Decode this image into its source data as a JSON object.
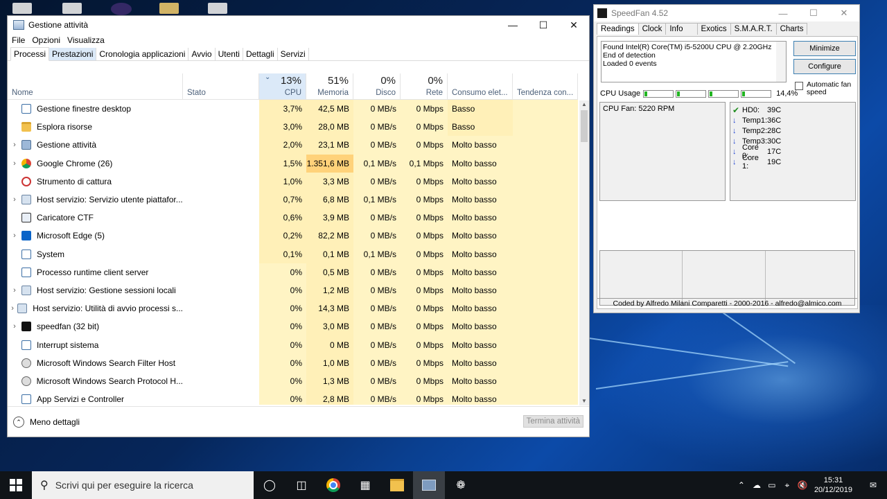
{
  "taskmanager": {
    "title": "Gestione attività",
    "menu": [
      "File",
      "Opzioni",
      "Visualizza"
    ],
    "tabs": [
      "Processi",
      "Prestazioni",
      "Cronologia applicazioni",
      "Avvio",
      "Utenti",
      "Dettagli",
      "Servizi"
    ],
    "columns": {
      "name": "Nome",
      "status": "Stato",
      "cpu_label": "CPU",
      "cpu_pct": "13%",
      "mem_label": "Memoria",
      "mem_pct": "51%",
      "disk_label": "Disco",
      "disk_pct": "0%",
      "net_label": "Rete",
      "net_pct": "0%",
      "power": "Consumo elet...",
      "trend": "Tendenza con..."
    },
    "processes": [
      {
        "name": "Gestione finestre desktop",
        "expand": false,
        "cpu": "3,7%",
        "mem": "42,5 MB",
        "disk": "0 MB/s",
        "net": "0 Mbps",
        "power": "Basso",
        "icon": "window-icon"
      },
      {
        "name": "Esplora risorse",
        "expand": false,
        "cpu": "3,0%",
        "mem": "28,0 MB",
        "disk": "0 MB/s",
        "net": "0 Mbps",
        "power": "Basso",
        "icon": "folder-icon"
      },
      {
        "name": "Gestione attività",
        "expand": true,
        "cpu": "2,0%",
        "mem": "23,1 MB",
        "disk": "0 MB/s",
        "net": "0 Mbps",
        "power": "Molto basso",
        "icon": "taskmanager-icon"
      },
      {
        "name": "Google Chrome (26)",
        "expand": true,
        "cpu": "1,5%",
        "mem": "1.351,6 MB",
        "disk": "0,1 MB/s",
        "net": "0,1 Mbps",
        "power": "Molto basso",
        "icon": "chrome-icon"
      },
      {
        "name": "Strumento di cattura",
        "expand": false,
        "cpu": "1,0%",
        "mem": "3,3 MB",
        "disk": "0 MB/s",
        "net": "0 Mbps",
        "power": "Molto basso",
        "icon": "scissors-icon"
      },
      {
        "name": "Host servizio: Servizio utente piattafor...",
        "expand": true,
        "cpu": "0,7%",
        "mem": "6,8 MB",
        "disk": "0,1 MB/s",
        "net": "0 Mbps",
        "power": "Molto basso",
        "icon": "gear-icon"
      },
      {
        "name": "Caricatore CTF",
        "expand": false,
        "cpu": "0,6%",
        "mem": "3,9 MB",
        "disk": "0 MB/s",
        "net": "0 Mbps",
        "power": "Molto basso",
        "icon": "pen-icon"
      },
      {
        "name": "Microsoft Edge (5)",
        "expand": true,
        "cpu": "0,2%",
        "mem": "82,2 MB",
        "disk": "0 MB/s",
        "net": "0 Mbps",
        "power": "Molto basso",
        "icon": "edge-icon"
      },
      {
        "name": "System",
        "expand": false,
        "cpu": "0,1%",
        "mem": "0,1 MB",
        "disk": "0,1 MB/s",
        "net": "0 Mbps",
        "power": "Molto basso",
        "icon": "window-icon"
      },
      {
        "name": "Processo runtime client server",
        "expand": false,
        "cpu": "0%",
        "mem": "0,5 MB",
        "disk": "0 MB/s",
        "net": "0 Mbps",
        "power": "Molto basso",
        "icon": "window-icon"
      },
      {
        "name": "Host servizio: Gestione sessioni locali",
        "expand": true,
        "cpu": "0%",
        "mem": "1,2 MB",
        "disk": "0 MB/s",
        "net": "0 Mbps",
        "power": "Molto basso",
        "icon": "gear-icon"
      },
      {
        "name": "Host servizio: Utilità di avvio processi s...",
        "expand": true,
        "cpu": "0%",
        "mem": "14,3 MB",
        "disk": "0 MB/s",
        "net": "0 Mbps",
        "power": "Molto basso",
        "icon": "gear-icon"
      },
      {
        "name": "speedfan (32 bit)",
        "expand": true,
        "cpu": "0%",
        "mem": "3,0 MB",
        "disk": "0 MB/s",
        "net": "0 Mbps",
        "power": "Molto basso",
        "icon": "fan-icon"
      },
      {
        "name": "Interrupt sistema",
        "expand": false,
        "cpu": "0%",
        "mem": "0 MB",
        "disk": "0 MB/s",
        "net": "0 Mbps",
        "power": "Molto basso",
        "icon": "window-icon"
      },
      {
        "name": "Microsoft Windows Search Filter Host",
        "expand": false,
        "cpu": "0%",
        "mem": "1,0 MB",
        "disk": "0 MB/s",
        "net": "0 Mbps",
        "power": "Molto basso",
        "icon": "search-person-icon"
      },
      {
        "name": "Microsoft Windows Search Protocol H...",
        "expand": false,
        "cpu": "0%",
        "mem": "1,3 MB",
        "disk": "0 MB/s",
        "net": "0 Mbps",
        "power": "Molto basso",
        "icon": "search-person-icon"
      },
      {
        "name": "App Servizi e Controller",
        "expand": false,
        "cpu": "0%",
        "mem": "2,8 MB",
        "disk": "0 MB/s",
        "net": "0 Mbps",
        "power": "Molto basso",
        "icon": "window-icon"
      }
    ],
    "footer": {
      "less_details": "Meno dettagli",
      "end_task": "Termina attività"
    }
  },
  "speedfan": {
    "title": "SpeedFan 4.52",
    "tabs": [
      "Readings",
      "Clock",
      "Info",
      "Exotics",
      "S.M.A.R.T.",
      "Charts"
    ],
    "log": [
      "Found Intel(R) Core(TM) i5-5200U CPU @ 2.20GHz",
      "End of detection",
      "Loaded 0 events"
    ],
    "buttons": {
      "minimize": "Minimize",
      "configure": "Configure"
    },
    "cpu_usage_label": "CPU Usage",
    "cpu_usage_value": "14,4%",
    "cpu_bars": [
      0.1,
      0.1,
      0.1,
      0.1
    ],
    "auto_fan_label": "Automatic fan speed",
    "fans": [
      "CPU Fan: 5220 RPM"
    ],
    "temps": [
      {
        "label": "HD0:",
        "value": "39C",
        "icon": "check"
      },
      {
        "label": "Temp1:",
        "value": "36C",
        "icon": "down"
      },
      {
        "label": "Temp2:",
        "value": "28C",
        "icon": "down"
      },
      {
        "label": "Temp3:",
        "value": "30C",
        "icon": "down"
      },
      {
        "label": "Core 0:",
        "value": "17C",
        "icon": "down"
      },
      {
        "label": "Core 1:",
        "value": "19C",
        "icon": "down"
      }
    ],
    "footer": "Coded by Alfredo Milani Comparetti - 2000-2016 - alfredo@almico.com"
  },
  "taskbar": {
    "search_placeholder": "Scrivi qui per eseguire la ricerca",
    "time": "15:31",
    "date": "20/12/2019"
  }
}
